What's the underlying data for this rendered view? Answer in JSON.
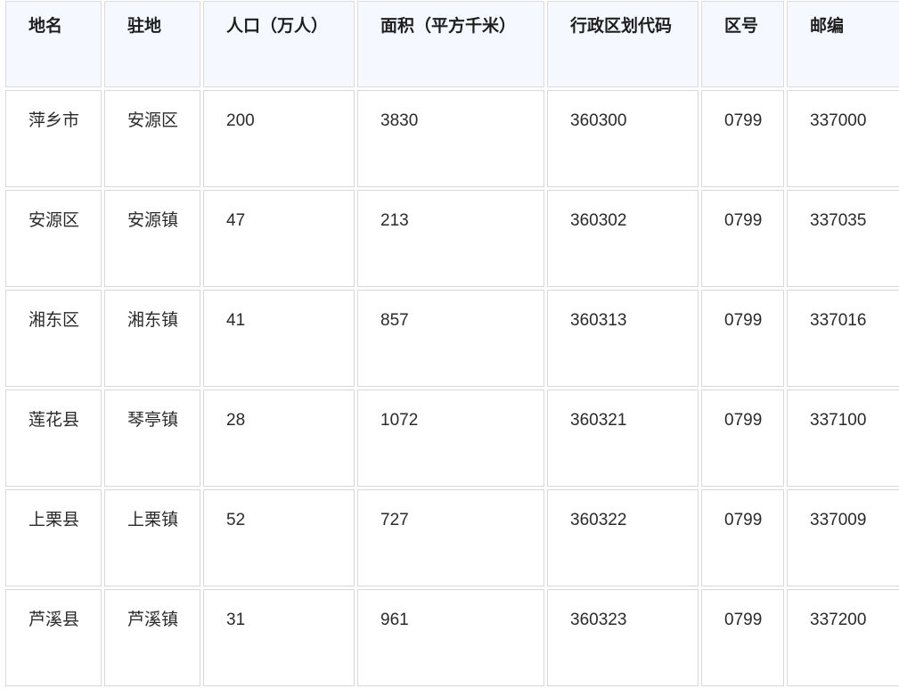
{
  "table": {
    "headers": [
      "地名",
      "驻地",
      "人口（万人）",
      "面积（平方千米）",
      "行政区划代码",
      "区号",
      "邮编"
    ],
    "rows": [
      [
        "萍乡市",
        "安源区",
        "200",
        "3830",
        "360300",
        "0799",
        "337000"
      ],
      [
        "安源区",
        "安源镇",
        "47",
        "213",
        "360302",
        "0799",
        "337035"
      ],
      [
        "湘东区",
        "湘东镇",
        "41",
        "857",
        "360313",
        "0799",
        "337016"
      ],
      [
        "莲花县",
        "琴亭镇",
        "28",
        "1072",
        "360321",
        "0799",
        "337100"
      ],
      [
        "上栗县",
        "上栗镇",
        "52",
        "727",
        "360322",
        "0799",
        "337009"
      ],
      [
        "芦溪县",
        "芦溪镇",
        "31",
        "961",
        "360323",
        "0799",
        "337200"
      ]
    ]
  },
  "colors": {
    "header_bg": "#f5f9ff",
    "border": "#d8d8d8"
  }
}
